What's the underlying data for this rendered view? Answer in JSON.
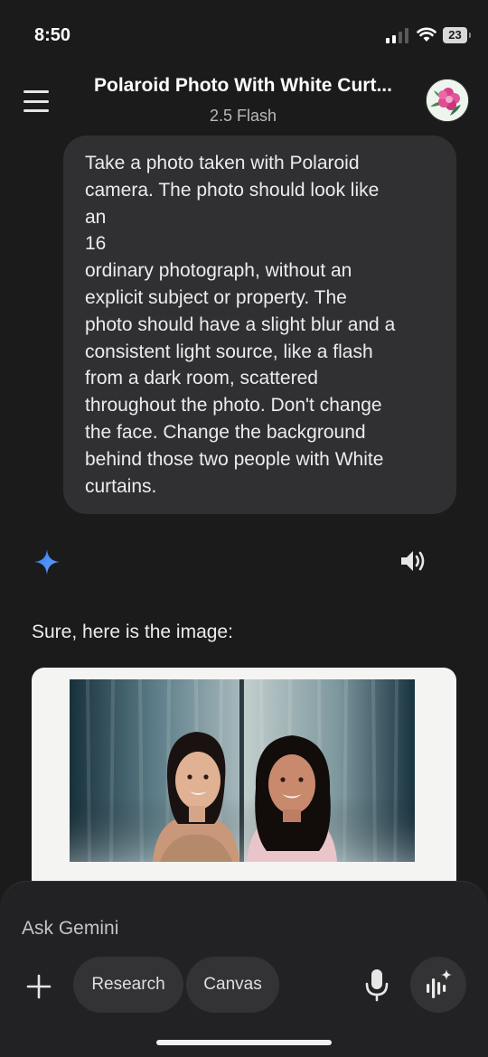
{
  "status_bar": {
    "time": "8:50",
    "battery": "23"
  },
  "header": {
    "title": "Polaroid Photo With White Curt...",
    "model": "2.5 Flash"
  },
  "conversation": {
    "user_message": "Take a photo taken with Polaroid\ncamera. The photo should look like\nan\n16\nordinary photograph, without an\nexplicit subject or property. The\nphoto should have a slight blur and a\nconsistent light source, like a flash\nfrom a dark room, scattered\nthroughout the photo. Don't change\nthe face. Change the background\nbehind those two people with White\ncurtains.",
    "response_text": "Sure, here is the image:"
  },
  "composer": {
    "placeholder": "Ask Gemini",
    "chips": [
      "Research",
      "Canvas"
    ]
  },
  "icons": {
    "menu": "hamburger-menu-icon",
    "avatar": "flower-avatar",
    "spark": "gemini-spark-icon",
    "speaker": "speaker-icon",
    "plus": "plus-icon",
    "mic": "microphone-icon",
    "live": "live-audio-icon"
  },
  "colors": {
    "background": "#1b1b1c",
    "bubble": "#303033",
    "spark_blue": "#4a8af4",
    "chip": "#333335"
  }
}
